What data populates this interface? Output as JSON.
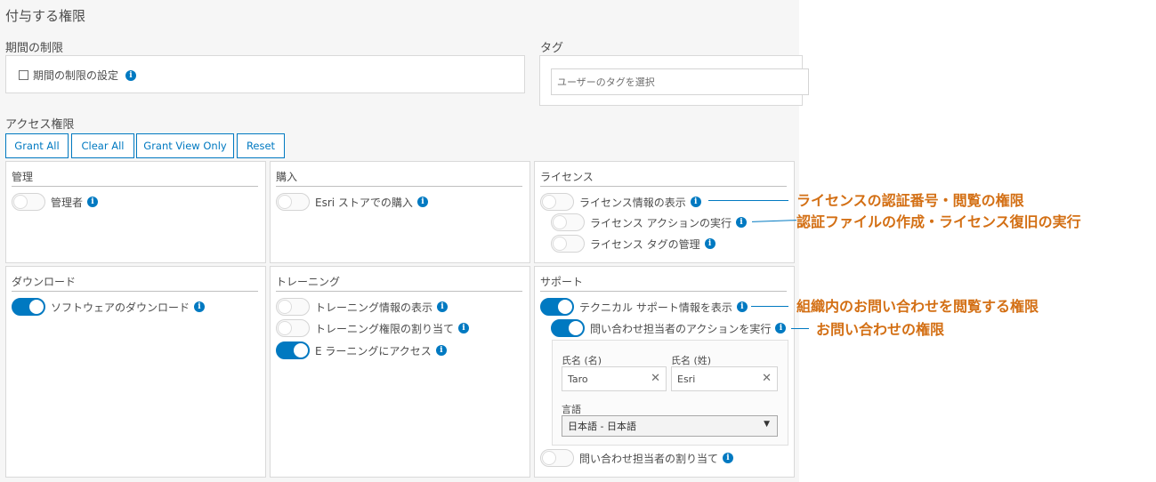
{
  "header": {
    "title": "付与する権限"
  },
  "period": {
    "heading": "期間の制限",
    "checkbox_label": "期間の制限の設定"
  },
  "tags": {
    "heading": "タグ",
    "placeholder": "ユーザーのタグを選択"
  },
  "access": {
    "heading": "アクセス権限",
    "buttons": {
      "grant_all": "Grant All",
      "clear_all": "Clear All",
      "grant_view_only": "Grant View Only",
      "reset": "Reset"
    }
  },
  "cards": {
    "admin": {
      "title": "管理",
      "items": [
        {
          "label": "管理者",
          "on": false
        }
      ]
    },
    "purchase": {
      "title": "購入",
      "items": [
        {
          "label": "Esri ストアでの購入",
          "on": false
        }
      ]
    },
    "license": {
      "title": "ライセンス",
      "items": [
        {
          "label": "ライセンス情報の表示",
          "on": false
        },
        {
          "label": "ライセンス アクションの実行",
          "on": false
        },
        {
          "label": "ライセンス タグの管理",
          "on": false
        }
      ]
    },
    "download": {
      "title": "ダウンロード",
      "items": [
        {
          "label": "ソフトウェアのダウンロード",
          "on": true
        }
      ]
    },
    "training": {
      "title": "トレーニング",
      "items": [
        {
          "label": "トレーニング情報の表示",
          "on": false
        },
        {
          "label": "トレーニング権限の割り当て",
          "on": false
        },
        {
          "label": "E ラーニングにアクセス",
          "on": true
        }
      ]
    },
    "support": {
      "title": "サポート",
      "items": [
        {
          "label": "テクニカル サポート情報を表示",
          "on": true
        },
        {
          "label": "問い合わせ担当者のアクションを実行",
          "on": true
        },
        {
          "label": "問い合わせ担当者の割り当て",
          "on": false
        }
      ],
      "form": {
        "first_name_label": "氏名 (名)",
        "first_name_value": "Taro",
        "last_name_label": "氏名 (姓)",
        "last_name_value": "Esri",
        "language_label": "言語",
        "language_value": "日本語 - 日本語"
      }
    }
  },
  "callouts": {
    "c1": "ライセンスの認証番号・閲覧の権限",
    "c2": "認証ファイルの作成・ライセンス復旧の実行",
    "c3": "組織内のお問い合わせを閲覧する権限",
    "c4": "お問い合わせの権限"
  },
  "colors": {
    "accent": "#0079c1",
    "callout": "#d36f14"
  }
}
